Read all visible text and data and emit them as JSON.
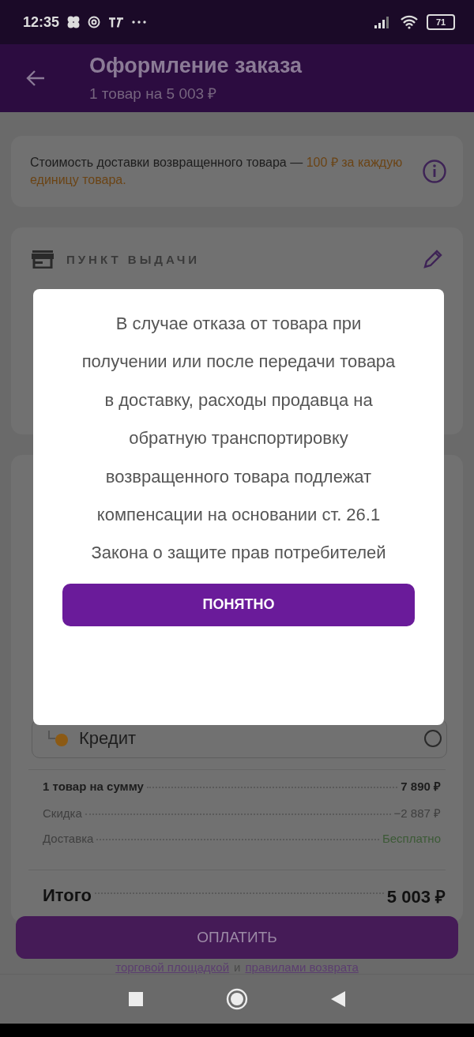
{
  "status_bar": {
    "time": "12:35",
    "battery": "71"
  },
  "header": {
    "title": "Оформление заказа",
    "subtitle": "1 товар на 5 003 ₽"
  },
  "notice": {
    "text": "Стоимость доставки возвращенного товара —",
    "highlight": "100 ₽ за каждую единицу товара."
  },
  "pickup": {
    "label": "ПУНКТ ВЫДАЧИ"
  },
  "payment_options": [
    {
      "label": "Кредит",
      "selected": false
    }
  ],
  "summary": [
    {
      "label": "1 товар на сумму",
      "value": "7 890 ₽",
      "kind": "bold"
    },
    {
      "label": "Скидка",
      "value": "−2 887 ₽",
      "kind": "muted"
    },
    {
      "label": "Доставка",
      "value": "Бесплатно",
      "kind": "free"
    }
  ],
  "total": {
    "label": "Итого",
    "value": "5 003 ₽"
  },
  "pay_button": "ОПЛАТИТЬ",
  "agreement_links": [
    "торговой площадкой",
    "и",
    "правилами возврата"
  ],
  "dialog": {
    "text": "В случае отказа от товара при получении или после передачи товара в доставку, расходы продавца на обратную транспортировку возвращенного товара подлежат компенсации на основании ст. 26.1 Закона о защите прав потребителей",
    "button": "ПОНЯТНО"
  }
}
